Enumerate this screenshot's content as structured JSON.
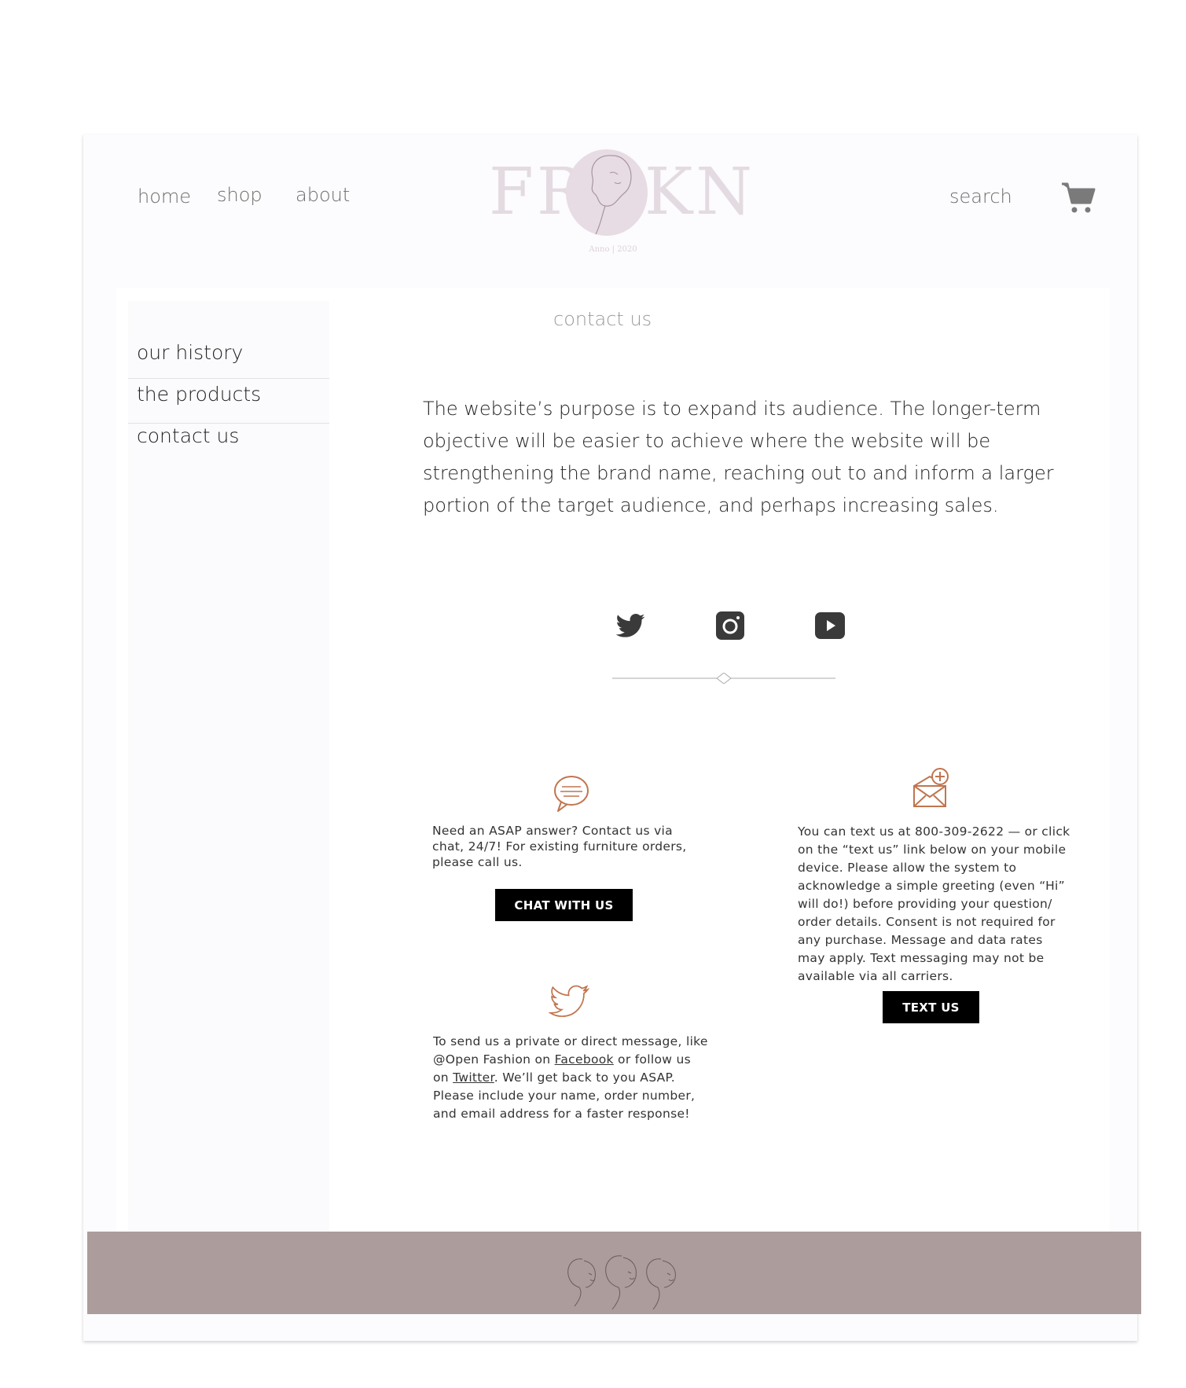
{
  "nav": {
    "home": "home",
    "shop": "shop",
    "about": "about",
    "search": "search"
  },
  "logo": {
    "text_left": "FR",
    "text_right": "KN",
    "tagline": "Anno | 2020"
  },
  "sidebar": {
    "items": [
      {
        "label": "our history"
      },
      {
        "label": "the products"
      },
      {
        "label": "contact us"
      }
    ]
  },
  "main": {
    "title": "contact us",
    "intro": "The website’s purpose is to expand its audience. The longer-term objective will be easier to achieve where the website will be strengthening the brand name, reaching out to and inform a larger portion of the target audience, and perhaps increasing sales."
  },
  "social": [
    "twitter-icon",
    "instagram-icon",
    "youtube-icon"
  ],
  "chat": {
    "text": "Need an ASAP answer? Contact us via chat, 24/7! For existing furniture orders, please call us.",
    "button": "CHAT WITH US"
  },
  "text_block": {
    "text": "You can text us at 800-309-2622 — or click on the “text us” link below on your mobile device. Please allow the system to acknowledge a simple greeting (even “Hi” will do!) before providing your question/ order details. Consent is not required for any purchase. Message and data rates may apply. Text messaging may not be available via all carriers.",
    "button": "TEXT US"
  },
  "dm": {
    "text_before": "To send us a private or direct message, like @Open Fashion on ",
    "facebook": "Facebook",
    "text_mid": " or follow us on ",
    "twitter": "Twitter",
    "text_after": ". We’ll get back to you ASAP. Please include your name, order number, and email address for a faster response!"
  },
  "colors": {
    "accent": "#c0754f",
    "footer": "#ac9c9c",
    "logo": "#e3dbe1",
    "button": "#000000"
  }
}
